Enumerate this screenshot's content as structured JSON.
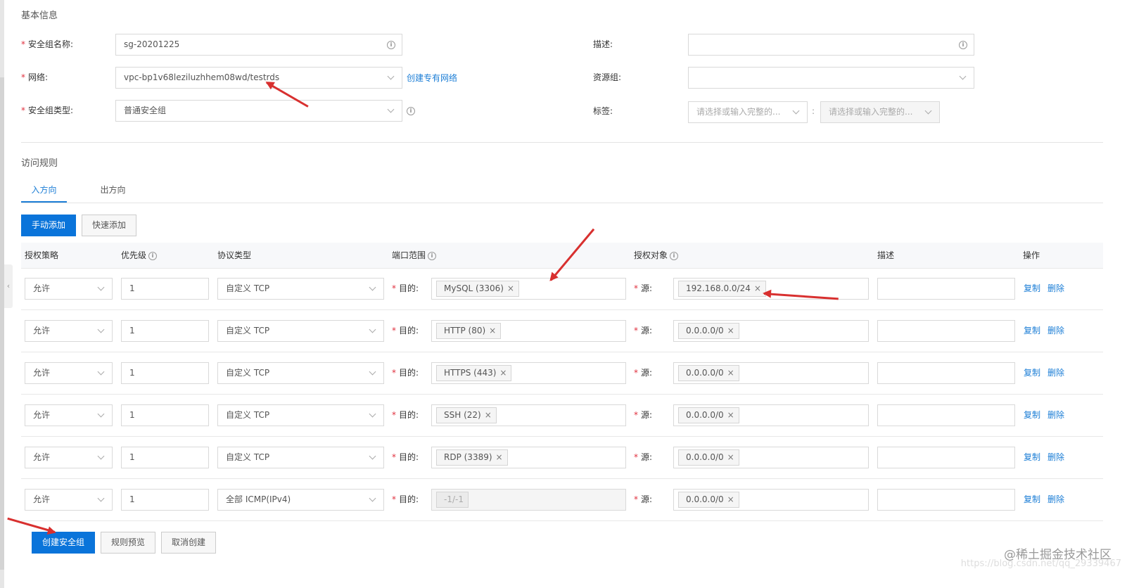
{
  "basic_info": {
    "title": "基本信息",
    "name_label": "安全组名称:",
    "name_value": "sg-20201225",
    "network_label": "网络:",
    "network_value": "vpc-bp1v68leziluzhhem08wd/testrds",
    "create_vpc_link": "创建专有网络",
    "type_label": "安全组类型:",
    "type_value": "普通安全组",
    "desc_label": "描述:",
    "desc_value": "",
    "resource_group_label": "资源组:",
    "resource_group_value": "",
    "tag_label": "标签:",
    "tag_key_placeholder": "请选择或输入完整的...",
    "tag_value_placeholder": "请选择或输入完整的...",
    "tag_separator": ":"
  },
  "access_rules": {
    "title": "访问规则",
    "tabs": [
      {
        "label": "入方向",
        "active": true
      },
      {
        "label": "出方向",
        "active": false
      }
    ],
    "manual_add": "手动添加",
    "quick_add": "快速添加",
    "columns": [
      "授权策略",
      "优先级",
      "协议类型",
      "端口范围",
      "授权对象",
      "描述",
      "操作"
    ],
    "dest_label": "目的:",
    "src_label": "源:",
    "copy_label": "复制",
    "delete_label": "删除",
    "rows": [
      {
        "policy": "允许",
        "priority": "1",
        "protocol": "自定义 TCP",
        "port": "MySQL (3306)",
        "source": "192.168.0.0/24",
        "desc": ""
      },
      {
        "policy": "允许",
        "priority": "1",
        "protocol": "自定义 TCP",
        "port": "HTTP (80)",
        "source": "0.0.0.0/0",
        "desc": ""
      },
      {
        "policy": "允许",
        "priority": "1",
        "protocol": "自定义 TCP",
        "port": "HTTPS (443)",
        "source": "0.0.0.0/0",
        "desc": ""
      },
      {
        "policy": "允许",
        "priority": "1",
        "protocol": "自定义 TCP",
        "port": "SSH (22)",
        "source": "0.0.0.0/0",
        "desc": ""
      },
      {
        "policy": "允许",
        "priority": "1",
        "protocol": "自定义 TCP",
        "port": "RDP (3389)",
        "source": "0.0.0.0/0",
        "desc": ""
      },
      {
        "policy": "允许",
        "priority": "1",
        "protocol": "全部 ICMP(IPv4)",
        "port": "-1/-1",
        "source": "0.0.0.0/0",
        "desc": ""
      }
    ]
  },
  "footer": {
    "create": "创建安全组",
    "preview": "规则预览",
    "cancel": "取消创建"
  },
  "watermark": "@稀土掘金技术社区",
  "watermark_url": "https://blog.csdn.net/qq_29339467",
  "icons": {
    "info": "info-circle-icon",
    "chevron": "chevron-down-icon",
    "tag_remove": "close-icon"
  },
  "colors": {
    "primary": "#0a74da",
    "link": "#1c7ed6",
    "required": "#e0313f",
    "annotation_arrow": "#d8302f"
  }
}
